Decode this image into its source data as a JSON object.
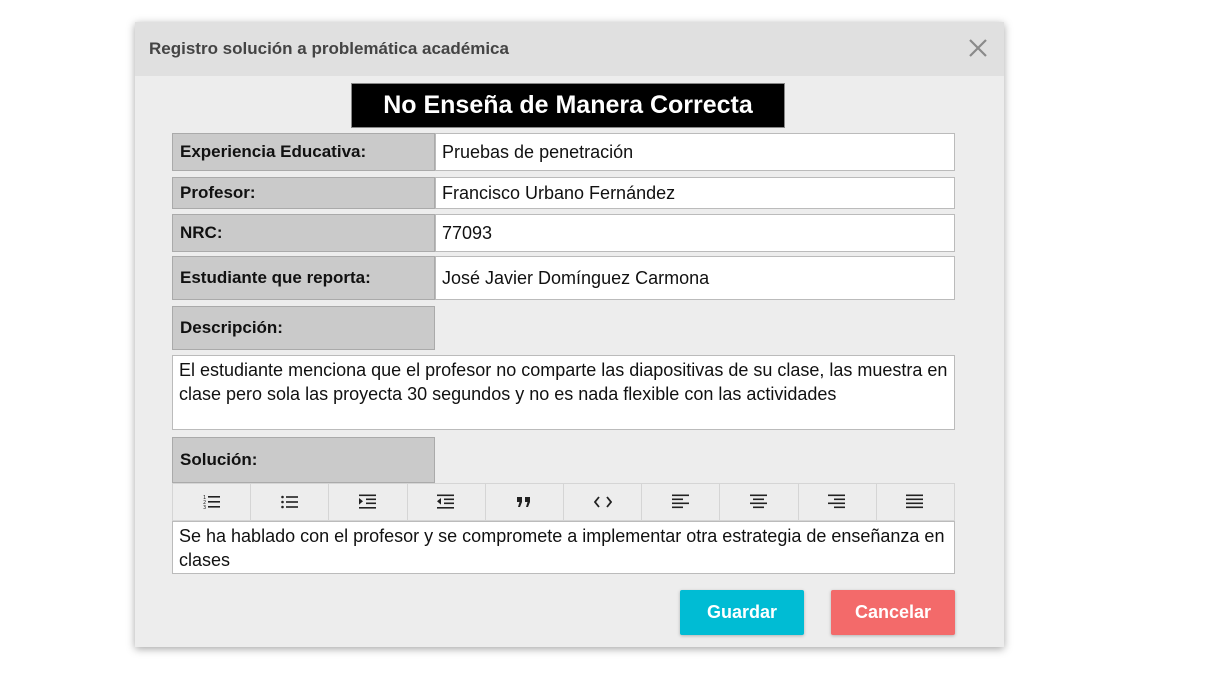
{
  "dialog": {
    "title": "Registro solución a problemática académica",
    "banner": "No Enseña de Manera Correcta"
  },
  "fields": {
    "experiencia_label": "Experiencia Educativa:",
    "experiencia_value": "Pruebas de penetración",
    "profesor_label": "Profesor:",
    "profesor_value": "Francisco Urbano Fernández",
    "nrc_label": "NRC:",
    "nrc_value": "77093",
    "estudiante_label": "Estudiante que reporta:",
    "estudiante_value": "José Javier Domínguez Carmona",
    "descripcion_label": "Descripción:",
    "descripcion_value": "El estudiante menciona que el profesor no comparte las diapositivas de su clase, las muestra en clase pero sola las proyecta 30 segundos y no es nada flexible con las actividades",
    "solucion_label": "Solución:",
    "solucion_value": "Se ha hablado con el profesor y se compromete a implementar otra estrategia de enseñanza en clases"
  },
  "toolbar": {
    "icons": [
      "ordered-list-icon",
      "bullet-list-icon",
      "indent-icon",
      "outdent-icon",
      "blockquote-icon",
      "code-icon",
      "align-left-icon",
      "align-center-icon",
      "align-right-icon",
      "align-justify-icon"
    ]
  },
  "buttons": {
    "save": "Guardar",
    "cancel": "Cancelar"
  },
  "colors": {
    "save": "#00bcd4",
    "cancel": "#f36a6a",
    "banner_bg": "#000000"
  }
}
